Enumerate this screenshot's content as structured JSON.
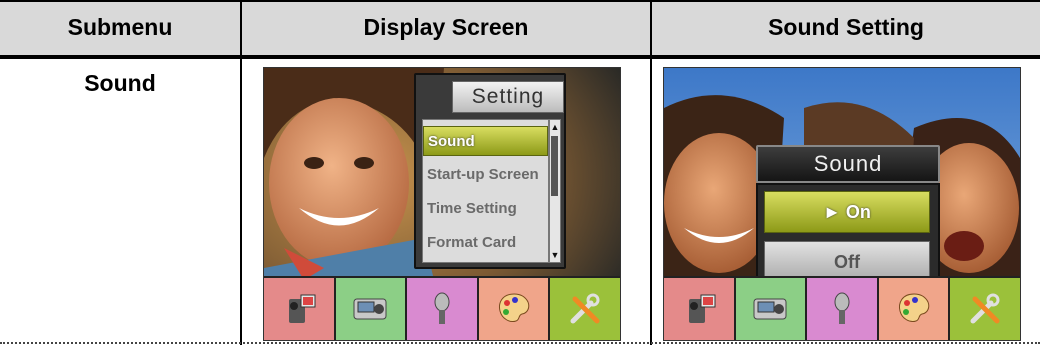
{
  "table": {
    "headers": [
      "Submenu",
      "Display Screen",
      "Sound Setting"
    ],
    "submenu": "Sound"
  },
  "display_screen": {
    "title": "Setting",
    "items": [
      "Sound",
      "Start-up Screen",
      "Time Setting",
      "Format Card"
    ],
    "selected_index": 0,
    "scroll_up": "▲",
    "scroll_down": "▼"
  },
  "sound_screen": {
    "title": "Sound",
    "options": [
      "► On",
      "Off"
    ],
    "selected_index": 0
  },
  "icon_bar": [
    "video-camera-icon",
    "camera-icon",
    "microphone-icon",
    "palette-icon",
    "tools-icon"
  ],
  "colors": {
    "header_bg": "#d9d9d9",
    "highlight": "#b2bb2a",
    "icon_tiles": [
      "#e48a8a",
      "#8ccf86",
      "#d98ad0",
      "#f0a58a",
      "#9bc13a"
    ]
  }
}
